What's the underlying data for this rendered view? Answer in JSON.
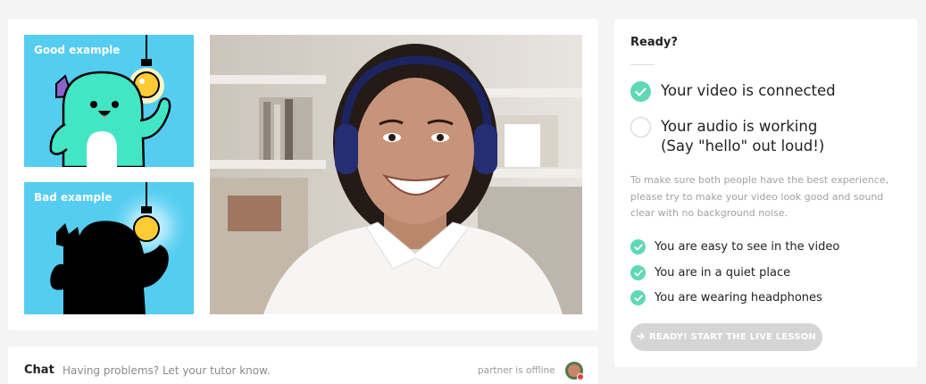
{
  "examples": {
    "good_label": "Good example",
    "bad_label": "Bad example"
  },
  "ready": {
    "title": "Ready?",
    "checks": [
      {
        "label": "Your video is connected",
        "done": true
      },
      {
        "label": "Your audio is working",
        "sub": "(Say \"hello\" out loud!)",
        "done": false
      }
    ],
    "note": "To make sure both people have the best experience, please try to make your video look good and sound clear with no background noise.",
    "tips": [
      "You are easy to see in the video",
      "You are in a quiet place",
      "You are wearing headphones"
    ],
    "start_button": "READY! START THE LIVE LESSON",
    "start_button_icon": "arrow-right-icon"
  },
  "chat": {
    "title": "Chat",
    "help": "Having problems? Let your tutor know.",
    "partner_status": "partner is offline"
  },
  "colors": {
    "accent_green": "#5fd9b5",
    "tile_blue": "#55cdf0",
    "disabled_button": "#d5d5d5",
    "offline_red": "#ee3a3a"
  }
}
